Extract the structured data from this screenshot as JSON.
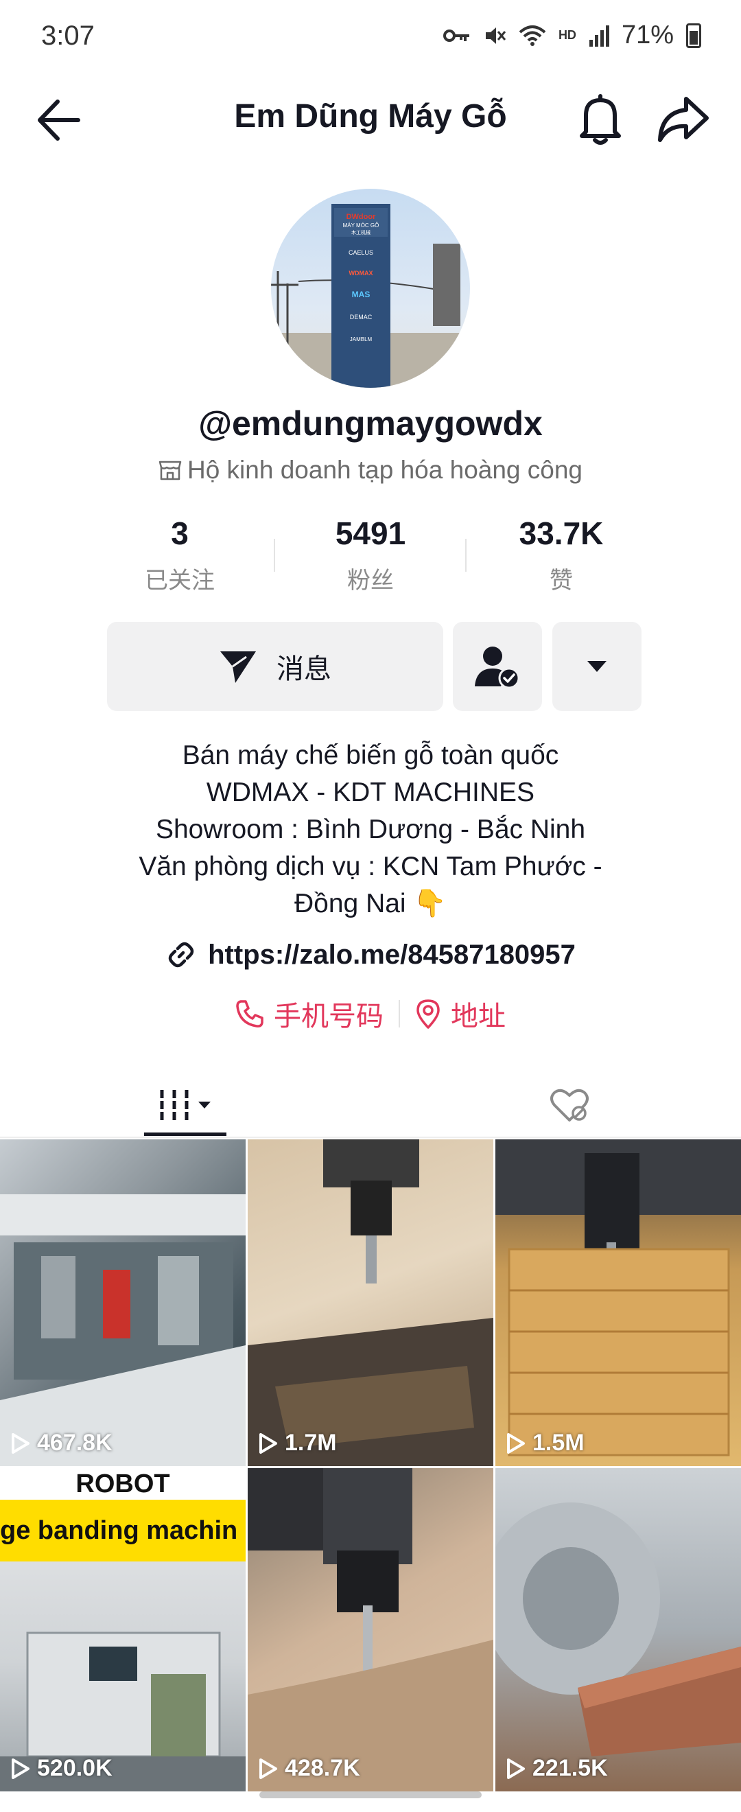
{
  "status_bar": {
    "time": "3:07",
    "battery": "71%",
    "network": "HD"
  },
  "header": {
    "title": "Em Dũng Máy Gỗ"
  },
  "avatar_sign": {
    "brand": "DWdoor",
    "line1": "MÁY MÓC GỖ",
    "line2": "木工机械",
    "logos": [
      "CAELUS",
      "WDMAX",
      "MAS",
      "DEMAC",
      "JAMBLM"
    ]
  },
  "profile": {
    "username": "@emdungmaygowdx",
    "business": "Hộ kinh doanh tạp hóa hoàng công"
  },
  "stats": [
    {
      "value": "3",
      "label": "已关注"
    },
    {
      "value": "5491",
      "label": "粉丝"
    },
    {
      "value": "33.7K",
      "label": "赞"
    }
  ],
  "actions": {
    "message": "消息"
  },
  "bio": [
    "Bán máy chế biến gỗ toàn quốc",
    "WDMAX - KDT MACHINES",
    "Showroom : Bình Dương - Bắc Ninh",
    "Văn phòng dịch vụ : KCN Tam Phước -",
    "Đồng Nai 👇"
  ],
  "link": "https://zalo.me/84587180957",
  "contacts": {
    "phone": "手机号码",
    "address": "地址"
  },
  "videos": [
    {
      "views": "467.8K"
    },
    {
      "views": "1.7M"
    },
    {
      "views": "1.5M"
    },
    {
      "views": "520.0K",
      "banner_top": "ROBOT",
      "banner_bottom": "ge banding machin"
    },
    {
      "views": "428.7K"
    },
    {
      "views": "221.5K"
    }
  ],
  "colors": {
    "accent": "#e2375b",
    "text": "#161823",
    "button_bg": "#f1f1f2"
  }
}
